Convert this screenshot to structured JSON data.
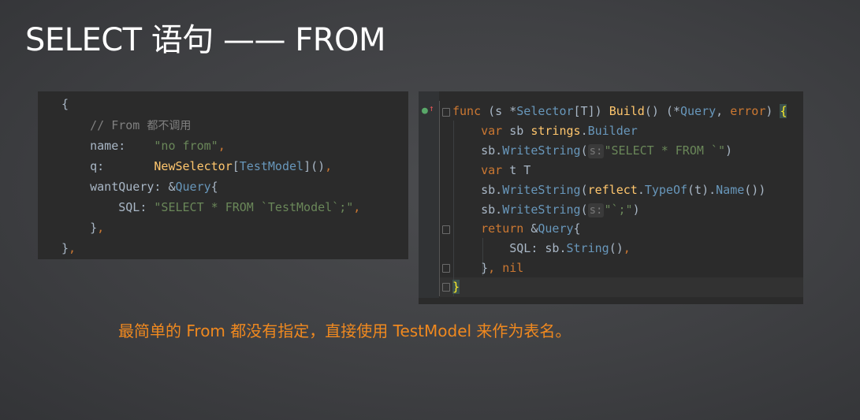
{
  "slide": {
    "title": "SELECT 语句 —— FROM",
    "caption": "最简单的 From 都没有指定，直接使用 TestModel 来作为表名。"
  },
  "left_code": {
    "l1": "{",
    "l2_comment": "// From ",
    "l2_note": "都不调用",
    "l3_key": "name:    ",
    "l3_val": "\"no from\"",
    "l3_comma": ",",
    "l4_key": "q:       ",
    "l4_fn": "NewSelector",
    "l4_b1": "[",
    "l4_type": "TestModel",
    "l4_b2": "]()",
    "l4_comma": ",",
    "l5_key": "wantQuery: &",
    "l5_type": "Query",
    "l5_brace": "{",
    "l6_key": "SQL: ",
    "l6_val": "\"SELECT * FROM `TestModel`;\"",
    "l6_comma": ",",
    "l7_brace": "}",
    "l7_comma": ",",
    "l8_brace": "}",
    "l8_comma": ","
  },
  "right_code": {
    "r1_func": "func",
    "r1_a": " (s *",
    "r1_type": "Selector",
    "r1_b": "[T]) ",
    "r1_fn": "Build",
    "r1_c": "() (*",
    "r1_type2": "Query",
    "r1_d": ", ",
    "r1_kw": "error",
    "r1_e": ") ",
    "r1_brace": "{",
    "r2_var": "var",
    "r2_a": " sb ",
    "r2_pkg": "strings",
    "r2_dot": ".",
    "r2_type": "Builder",
    "r3_a": "sb.",
    "r3_fn": "WriteString",
    "r3_b": "(",
    "r3_hint": "s:",
    "r3_str": "\"SELECT * FROM `\"",
    "r3_c": ")",
    "r4_var": "var",
    "r4_a": " t T",
    "r5_a": "sb.",
    "r5_fn": "WriteString",
    "r5_b": "(",
    "r5_pkg": "reflect",
    "r5_c": ".",
    "r5_fn2": "TypeOf",
    "r5_d": "(t).",
    "r5_fn3": "Name",
    "r5_e": "())",
    "r6_a": "sb.",
    "r6_fn": "WriteString",
    "r6_b": "(",
    "r6_hint": "s:",
    "r6_str": "\"`;\"",
    "r6_c": ")",
    "r7_return": "return",
    "r7_a": " &",
    "r7_type": "Query",
    "r7_b": "{",
    "r8_a": "SQL: sb.",
    "r8_fn": "String",
    "r8_b": "()",
    "r8_comma": ",",
    "r9_a": "}",
    "r9_comma": ",",
    "r9_nil": " nil",
    "r10_brace": "}"
  },
  "colors": {
    "background": "#3f4043",
    "editor_bg": "#2b2b2b",
    "keyword": "#cc7832",
    "string": "#6a8759",
    "function": "#ffc66d",
    "type": "#6897bb",
    "caption": "#f0891f"
  },
  "icons": {
    "run": "run-test-icon",
    "arrow": "implementation-arrow-icon"
  }
}
